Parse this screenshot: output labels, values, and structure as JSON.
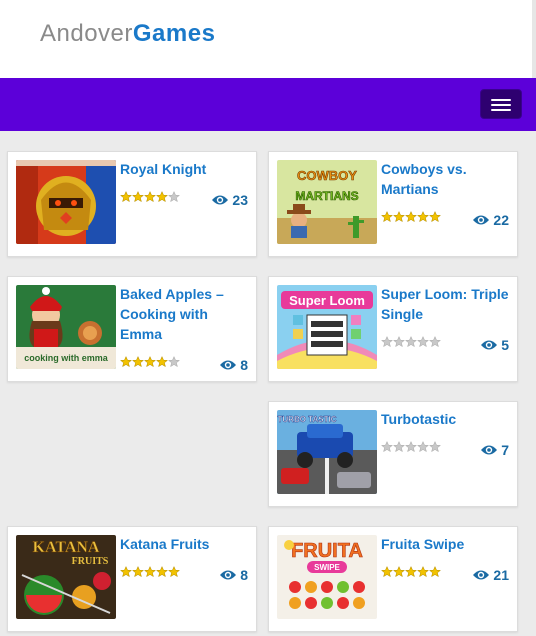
{
  "logo": {
    "part1": "Andover",
    "part2": "Games"
  },
  "navbar": {
    "menu_icon": "hamburger-icon"
  },
  "colors": {
    "nav": "#5c00d9",
    "link": "#1a79c9",
    "views": "#1a6aa3",
    "star_on": "#f2c200",
    "star_off": "#c8c8c8"
  },
  "games": [
    {
      "title": "Royal Knight",
      "views": "23",
      "rating": 4
    },
    {
      "title": "Cowboys vs. Martians",
      "views": "22",
      "rating": 5
    },
    {
      "title": "Baked Apples – Cooking with Emma",
      "views": "8",
      "rating": 4
    },
    {
      "title": "Super Loom: Triple Single",
      "views": "5",
      "rating": 0
    },
    {
      "title": "Turbotastic",
      "views": "7",
      "rating": 0
    },
    {
      "title": "Katana Fruits",
      "views": "8",
      "rating": 5
    },
    {
      "title": "Fruita Swipe",
      "views": "21",
      "rating": 5
    }
  ],
  "thumb_text": {
    "cowboys": "COWBOY",
    "martians": "MARTIANS",
    "emma": "cooking with emma",
    "loom": "Super Loom",
    "turbo": "TURBO TASTIC",
    "katana": "KATANA",
    "fruits": "FRUITS",
    "fruita": "FRUITA",
    "swipe": "SWIPE"
  }
}
